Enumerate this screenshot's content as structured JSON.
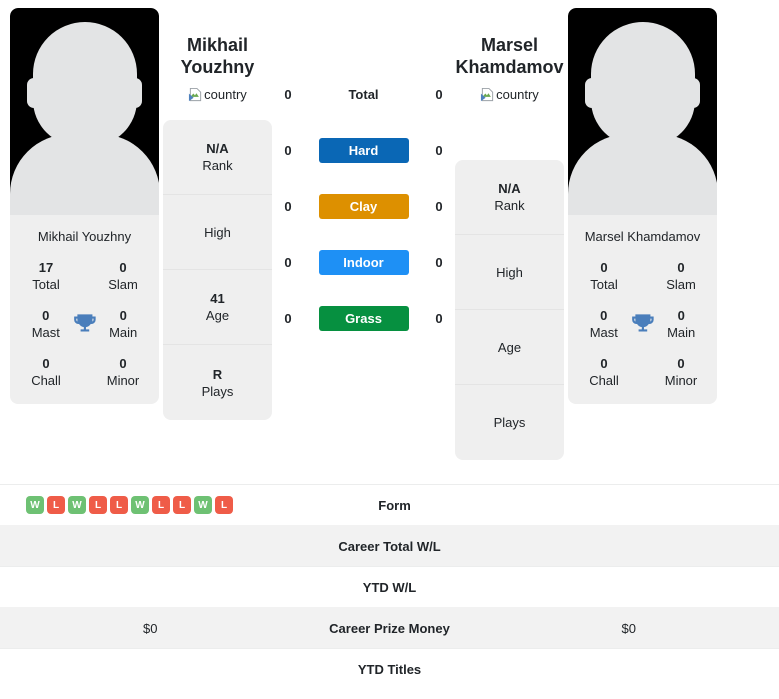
{
  "players": {
    "left": {
      "display_name": "Mikhail Youzhny",
      "heading_line1": "Mikhail",
      "heading_line2": "Youzhny",
      "country_alt": "country",
      "titles": [
        {
          "value": "17",
          "label": "Total"
        },
        {
          "value": "0",
          "label": "Slam"
        },
        {
          "value": "0",
          "label": "Mast"
        },
        {
          "value": "0",
          "label": "Main"
        },
        {
          "value": "0",
          "label": "Chall"
        },
        {
          "value": "0",
          "label": "Minor"
        }
      ],
      "info": [
        {
          "value": "N/A",
          "label": "Rank"
        },
        {
          "value": "",
          "label": "High"
        },
        {
          "value": "41",
          "label": "Age"
        },
        {
          "value": "R",
          "label": "Plays"
        }
      ],
      "surface_wins": {
        "total": "0",
        "hard": "0",
        "clay": "0",
        "indoor": "0",
        "grass": "0"
      },
      "form": [
        "W",
        "L",
        "W",
        "L",
        "L",
        "W",
        "L",
        "L",
        "W",
        "L"
      ],
      "career_total_wl": "",
      "ytd_wl": "",
      "career_prize_money": "$0",
      "ytd_titles": ""
    },
    "right": {
      "display_name": "Marsel Khamdamov",
      "heading_line1": "Marsel",
      "heading_line2": "Khamdamov",
      "country_alt": "country",
      "titles": [
        {
          "value": "0",
          "label": "Total"
        },
        {
          "value": "0",
          "label": "Slam"
        },
        {
          "value": "0",
          "label": "Mast"
        },
        {
          "value": "0",
          "label": "Main"
        },
        {
          "value": "0",
          "label": "Chall"
        },
        {
          "value": "0",
          "label": "Minor"
        }
      ],
      "info": [
        {
          "value": "N/A",
          "label": "Rank"
        },
        {
          "value": "",
          "label": "High"
        },
        {
          "value": "",
          "label": "Age"
        },
        {
          "value": "",
          "label": "Plays"
        }
      ],
      "surface_wins": {
        "total": "0",
        "hard": "0",
        "clay": "0",
        "indoor": "0",
        "grass": "0"
      },
      "form": [],
      "career_total_wl": "",
      "ytd_wl": "",
      "career_prize_money": "$0",
      "ytd_titles": ""
    }
  },
  "surfaces": [
    {
      "key": "total",
      "label": "Total",
      "color": ""
    },
    {
      "key": "hard",
      "label": "Hard",
      "color": "#0a67b5"
    },
    {
      "key": "clay",
      "label": "Clay",
      "color": "#dd9000"
    },
    {
      "key": "indoor",
      "label": "Indoor",
      "color": "#1e90f5"
    },
    {
      "key": "grass",
      "label": "Grass",
      "color": "#069040"
    }
  ],
  "stats_rows": [
    {
      "label": "Form",
      "key": "form"
    },
    {
      "label": "Career Total W/L",
      "key": "career_total_wl"
    },
    {
      "label": "YTD W/L",
      "key": "ytd_wl"
    },
    {
      "label": "Career Prize Money",
      "key": "career_prize_money"
    },
    {
      "label": "YTD Titles",
      "key": "ytd_titles"
    }
  ],
  "colors": {
    "win": "#6ec173",
    "loss": "#ef5c48",
    "card_bg": "#efefef",
    "shaded_row": "#f2f2f2",
    "trophy": "#4a7ebb"
  }
}
